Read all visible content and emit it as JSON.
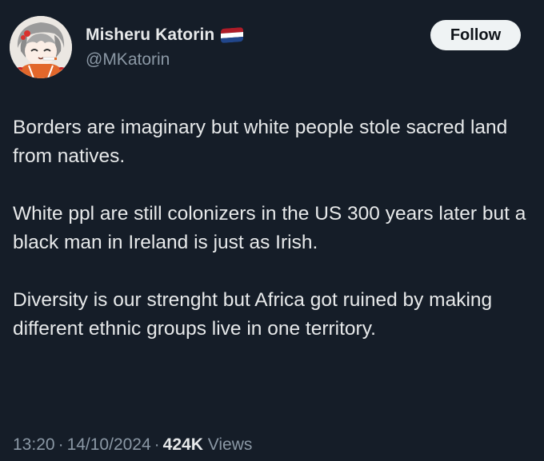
{
  "user": {
    "display_name": "Misheru Katorin",
    "handle": "@MKatorin",
    "flag_icon": "netherlands-flag-icon",
    "flag_colors": [
      "#ae1c28",
      "#ffffff",
      "#21468b"
    ]
  },
  "follow_button": {
    "label": "Follow"
  },
  "tweet": {
    "paragraphs": [
      "Borders are imaginary but white people stole sacred land from natives.",
      "White ppl are still colonizers in the US 300 years later but a black man in Ireland is just as Irish.",
      "Diversity is our strenght but Africa got ruined by making different ethnic groups live in one territory."
    ]
  },
  "meta": {
    "time": "13:20",
    "separator": "·",
    "date": "14/10/2024",
    "views_count": "424K",
    "views_label": "Views"
  },
  "colors": {
    "background": "#151d28",
    "text": "#e7e9ea",
    "secondary_text": "#8b98a5",
    "button_bg": "#eff3f4"
  }
}
